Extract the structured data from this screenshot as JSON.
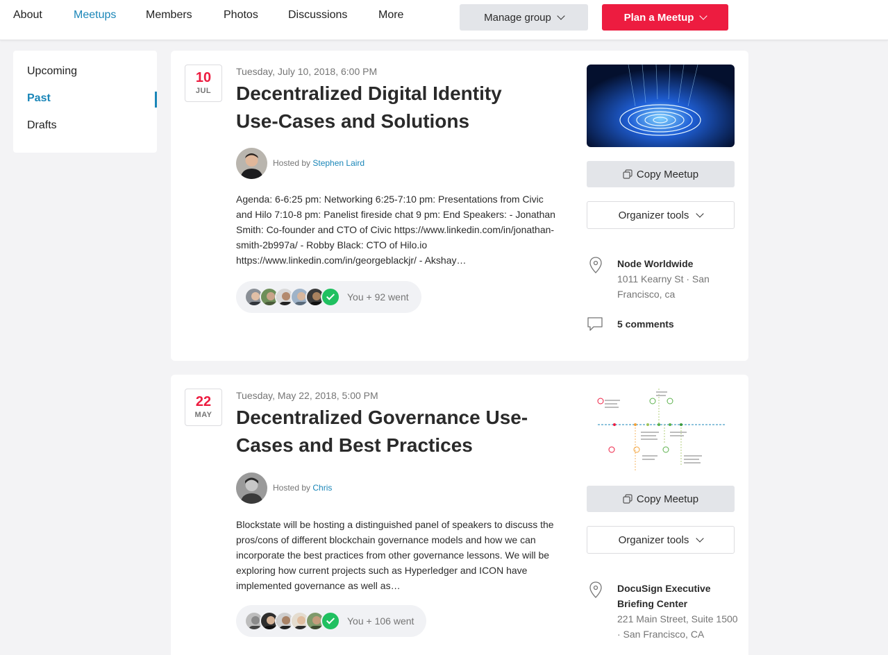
{
  "nav": {
    "items": [
      "About",
      "Meetups",
      "Members",
      "Photos",
      "Discussions",
      "More"
    ],
    "active": "Meetups",
    "manage_label": "Manage group",
    "plan_label": "Plan a Meetup",
    "accent": "#1a86b8",
    "brand_red": "#ed1c40"
  },
  "sidebar": {
    "items": [
      {
        "label": "Upcoming"
      },
      {
        "label": "Past"
      },
      {
        "label": "Drafts"
      }
    ],
    "active": "Past"
  },
  "events": [
    {
      "day": "10",
      "month": "JUL",
      "datetime": "Tuesday, July 10, 2018, 6:00 PM",
      "title": "Decentralized Digital Identity Use-Cases and Solutions",
      "hosted_prefix": "Hosted by",
      "host": "Stephen Laird",
      "description": "Agenda: 6-6:25 pm: Networking 6:25-7:10 pm: Presentations from Civic and Hilo 7:10-8 pm: Panelist fireside chat 9 pm: End Speakers: - Jonathan Smith: Co-founder and CTO of Civic https://www.linkedin.com/in/jonathan-smith-2b997a/ - Robby Black: CTO of Hilo.io https://www.linkedin.com/in/georgeblackjr/ - Akshay…",
      "went": "You + 92 went",
      "copy_label": "Copy Meetup",
      "organizer_label": "Organizer tools",
      "venue_name": "Node Worldwide",
      "venue_address": "1011 Kearny St · San Francisco, ca",
      "comments": "5 comments",
      "thumbnail": "fingerprint-image"
    },
    {
      "day": "22",
      "month": "MAY",
      "datetime": "Tuesday, May 22, 2018, 5:00 PM",
      "title": "Decentralized Governance Use-Cases and Best Practices",
      "hosted_prefix": "Hosted by",
      "host": "Chris",
      "description": "Blockstate will be hosting a distinguished panel of speakers to discuss the pros/cons of different blockchain governance models and how we can incorporate the best practices from other governance lessons. We will be exploring how current projects such as Hyperledger and ICON have implemented governance as well as…",
      "went": "You + 106 went",
      "copy_label": "Copy Meetup",
      "organizer_label": "Organizer tools",
      "venue_name": "DocuSign Executive Briefing Center",
      "venue_address": "221 Main Street, Suite 1500 · San Francisco, CA",
      "thumbnail": "governance-diagram-image"
    }
  ]
}
